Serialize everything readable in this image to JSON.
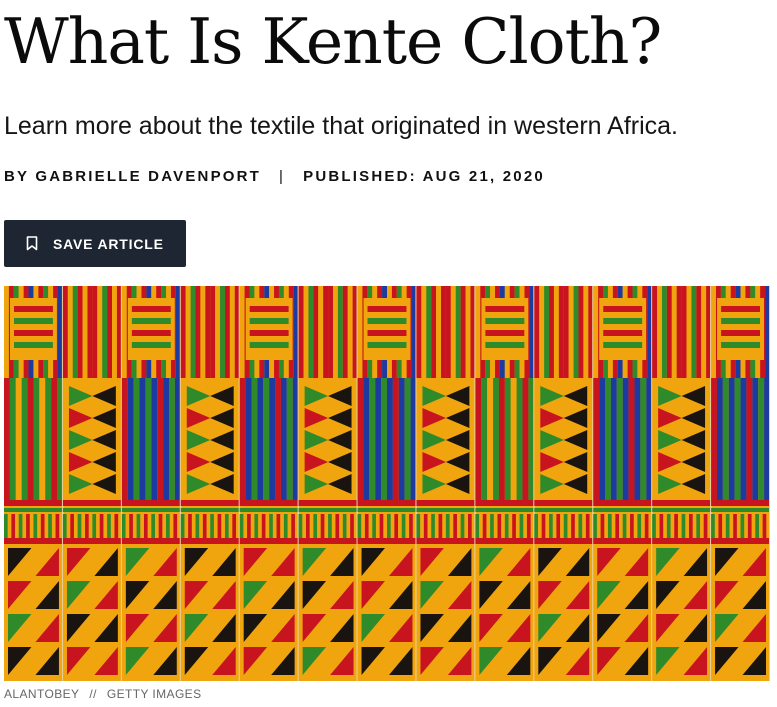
{
  "article": {
    "headline": "What Is Kente Cloth?",
    "dek": "Learn more about the textile that originated in western Africa.",
    "byline": "BY GABRIELLE DAVENPORT",
    "separator": "|",
    "published": "PUBLISHED: AUG 21, 2020"
  },
  "save_button": {
    "label": "SAVE ARTICLE",
    "icon": "bookmark-icon"
  },
  "hero_image": {
    "subject": "kente cloth textile",
    "credit_author": "ALANTOBEY",
    "credit_sep": "//",
    "credit_agency": "GETTY IMAGES"
  },
  "colors": {
    "button_bg": "#1e2633",
    "kente_gold": "#f0a50f",
    "kente_red": "#c8141e",
    "kente_green": "#2f8a2a",
    "kente_blue": "#1c3aa0",
    "kente_black": "#1a1410",
    "credit_text": "#666666"
  }
}
